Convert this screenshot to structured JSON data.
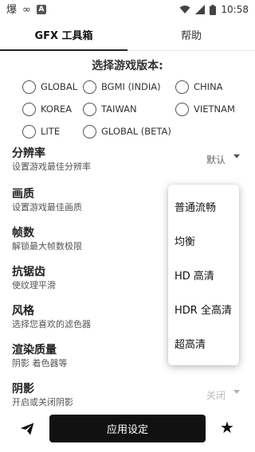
{
  "status_bar": {
    "left_icons": [
      "app-notification-icon",
      "infinity-icon",
      "a-box-icon"
    ],
    "app_glyph": "爆",
    "loop_glyph": "∞",
    "a_glyph": "A",
    "time": "10:58"
  },
  "tabs": [
    {
      "label": "GFX 工具箱",
      "active": true
    },
    {
      "label": "帮助",
      "active": false
    }
  ],
  "version": {
    "title": "选择游戏版本:",
    "options": [
      [
        "GLOBAL",
        "BGMI (INDIA)",
        "CHINA"
      ],
      [
        "KOREA",
        "TAIWAN",
        "VIETNAM"
      ],
      [
        "LITE",
        "GLOBAL (BETA)"
      ]
    ]
  },
  "settings": [
    {
      "title": "分辨率",
      "desc": "设置游戏最佳分辨率",
      "value": "默认"
    },
    {
      "title": "画质",
      "desc": "设置游戏最佳画质"
    },
    {
      "title": "帧数",
      "desc": "解锁最大帧数极限"
    },
    {
      "title": "抗锯齿",
      "desc": "使纹理平滑"
    },
    {
      "title": "风格",
      "desc": "选择您喜欢的滤色器"
    },
    {
      "title": "渲染质量",
      "desc": "阴影 着色器等"
    },
    {
      "title": "阴影",
      "desc": "开启或关闭阴影",
      "value": "关闭"
    }
  ],
  "quality_menu": [
    "普通流畅",
    "均衡",
    "HD 高清",
    "HDR 全高清",
    "超高清"
  ],
  "bottom": {
    "apply_label": "应用设定",
    "star_glyph": "★"
  },
  "colors": {
    "accent": "#111111",
    "background": "#ffffff"
  }
}
